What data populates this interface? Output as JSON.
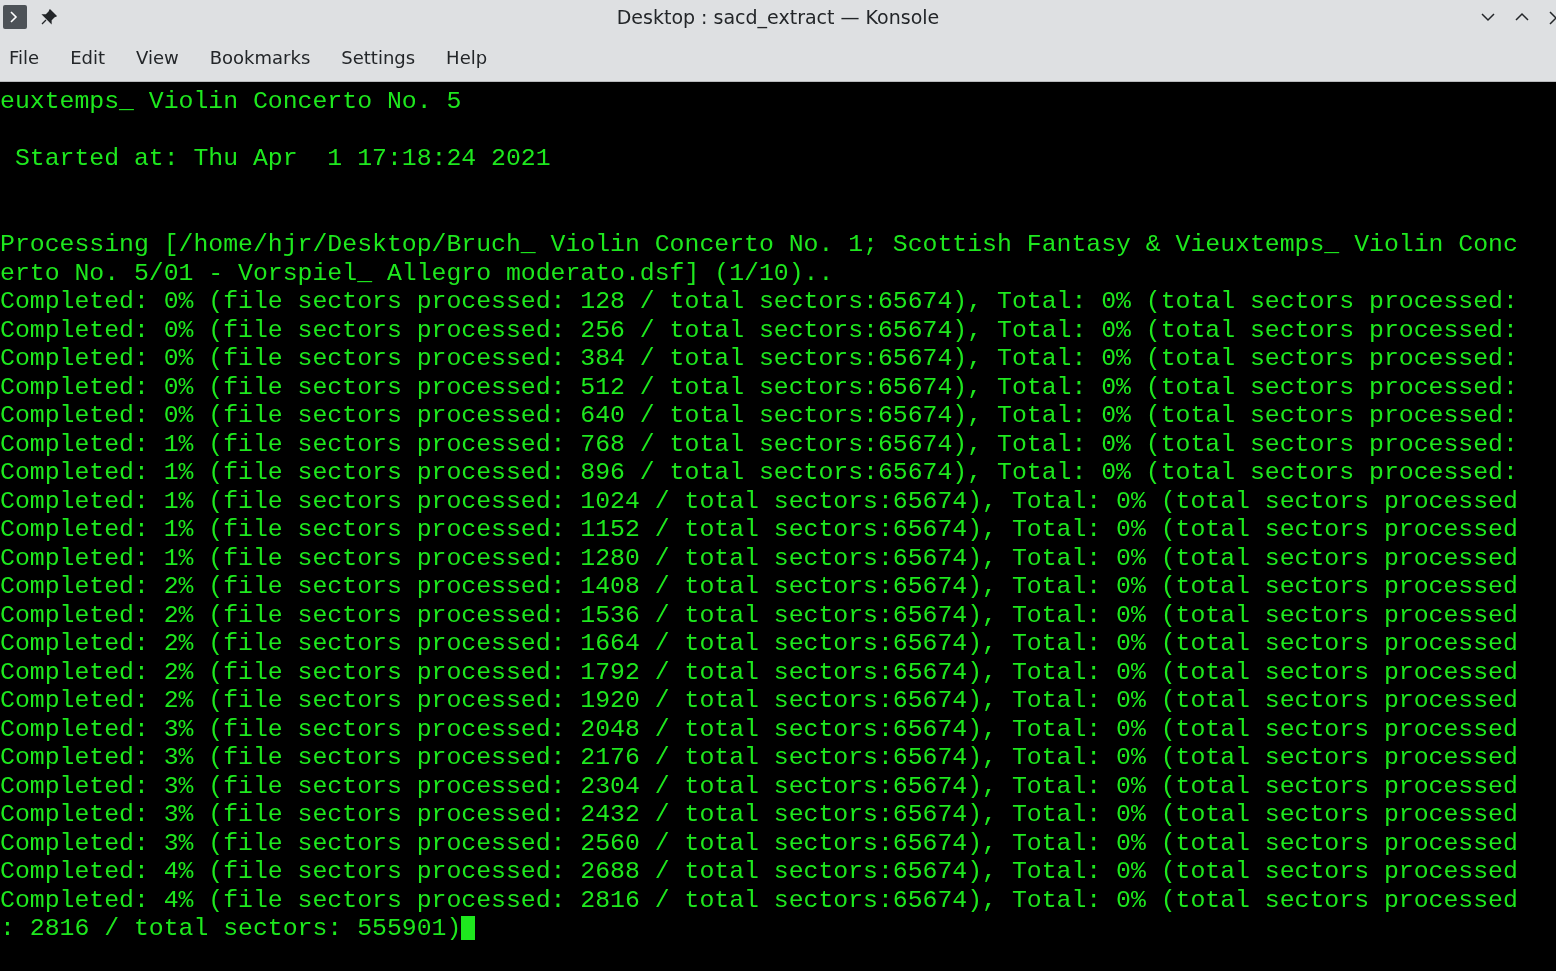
{
  "window": {
    "title": "Desktop : sacd_extract — Konsole"
  },
  "menu": [
    "File",
    "Edit",
    "View",
    "Bookmarks",
    "Settings",
    "Help"
  ],
  "terminal": {
    "title_line": "euxtemps_ Violin Concerto No. 5",
    "started_line": " Started at: Thu Apr  1 17:18:24 2021",
    "processing_lines": [
      "Processing [/home/hjr/Desktop/Bruch_ Violin Concerto No. 1; Scottish Fantasy & Vieuxtemps_ Violin Conc",
      "erto No. 5/01 - Vorspiel_ Allegro moderato.dsf] (1/10).."
    ],
    "progress_lines": [
      "Completed: 0% (file sectors processed: 128 / total sectors:65674), Total: 0% (total sectors processed:",
      "Completed: 0% (file sectors processed: 256 / total sectors:65674), Total: 0% (total sectors processed:",
      "Completed: 0% (file sectors processed: 384 / total sectors:65674), Total: 0% (total sectors processed:",
      "Completed: 0% (file sectors processed: 512 / total sectors:65674), Total: 0% (total sectors processed:",
      "Completed: 0% (file sectors processed: 640 / total sectors:65674), Total: 0% (total sectors processed:",
      "Completed: 1% (file sectors processed: 768 / total sectors:65674), Total: 0% (total sectors processed:",
      "Completed: 1% (file sectors processed: 896 / total sectors:65674), Total: 0% (total sectors processed:",
      "Completed: 1% (file sectors processed: 1024 / total sectors:65674), Total: 0% (total sectors processed",
      "Completed: 1% (file sectors processed: 1152 / total sectors:65674), Total: 0% (total sectors processed",
      "Completed: 1% (file sectors processed: 1280 / total sectors:65674), Total: 0% (total sectors processed",
      "Completed: 2% (file sectors processed: 1408 / total sectors:65674), Total: 0% (total sectors processed",
      "Completed: 2% (file sectors processed: 1536 / total sectors:65674), Total: 0% (total sectors processed",
      "Completed: 2% (file sectors processed: 1664 / total sectors:65674), Total: 0% (total sectors processed",
      "Completed: 2% (file sectors processed: 1792 / total sectors:65674), Total: 0% (total sectors processed",
      "Completed: 2% (file sectors processed: 1920 / total sectors:65674), Total: 0% (total sectors processed",
      "Completed: 3% (file sectors processed: 2048 / total sectors:65674), Total: 0% (total sectors processed",
      "Completed: 3% (file sectors processed: 2176 / total sectors:65674), Total: 0% (total sectors processed",
      "Completed: 3% (file sectors processed: 2304 / total sectors:65674), Total: 0% (total sectors processed",
      "Completed: 3% (file sectors processed: 2432 / total sectors:65674), Total: 0% (total sectors processed",
      "Completed: 3% (file sectors processed: 2560 / total sectors:65674), Total: 0% (total sectors processed",
      "Completed: 4% (file sectors processed: 2688 / total sectors:65674), Total: 0% (total sectors processed",
      "Completed: 4% (file sectors processed: 2816 / total sectors:65674), Total: 0% (total sectors processed"
    ],
    "last_line": ": 2816 / total sectors: 555901)"
  }
}
